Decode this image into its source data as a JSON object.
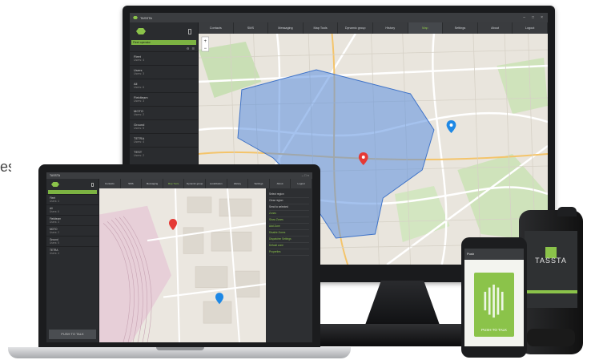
{
  "edge_text": "es",
  "monitor": {
    "app_name": "TASSTA",
    "window_buttons": [
      "–",
      "□",
      "×"
    ],
    "user_label": "Fleet operator",
    "tabs": [
      {
        "label": "Contacts",
        "active": false
      },
      {
        "label": "SMS",
        "active": false
      },
      {
        "label": "Messaging",
        "active": false
      },
      {
        "label": "Map Tools",
        "active": false
      },
      {
        "label": "Dynamic group",
        "active": false
      },
      {
        "label": "History",
        "active": false
      },
      {
        "label": "Map",
        "active": true
      },
      {
        "label": "Settings",
        "active": false
      },
      {
        "label": "About",
        "active": false
      },
      {
        "label": "Logout",
        "active": false
      }
    ],
    "groups": [
      {
        "name": "Fleet",
        "sub": "Users: 4"
      },
      {
        "name": "Users",
        "sub": "Users: 3"
      },
      {
        "name": "All",
        "sub": "Users: 6"
      },
      {
        "name": "Fieldteam",
        "sub": "Users: 3"
      },
      {
        "name": "MOTO",
        "sub": "Users: 2"
      },
      {
        "name": "Ground",
        "sub": "Users: 5"
      },
      {
        "name": "TETRA",
        "sub": "Users: 4"
      },
      {
        "name": "TEST",
        "sub": "Users: 2"
      }
    ]
  },
  "laptop": {
    "app_name": "TASSTA",
    "tabs": [
      {
        "label": "Contacts",
        "active": false
      },
      {
        "label": "SMS",
        "active": false
      },
      {
        "label": "Messaging",
        "active": false
      },
      {
        "label": "Map Tools",
        "active": true
      },
      {
        "label": "Dynamic group",
        "active": false
      },
      {
        "label": "Localization",
        "active": false
      },
      {
        "label": "History",
        "active": false
      },
      {
        "label": "Settings",
        "active": false
      },
      {
        "label": "About",
        "active": false
      },
      {
        "label": "Logout",
        "active": false
      }
    ],
    "groups": [
      {
        "name": "Fleet",
        "sub": "Users: 4"
      },
      {
        "name": "All",
        "sub": "Users: 6"
      },
      {
        "name": "Fieldteam",
        "sub": "Users: 3"
      },
      {
        "name": "MOTO",
        "sub": "Users: 2"
      },
      {
        "name": "Ground",
        "sub": "Users: 5"
      },
      {
        "name": "TETRA",
        "sub": "Users: 4"
      }
    ],
    "ptt_label": "PUSH TO TALK",
    "panel_items": [
      {
        "label": "Select region",
        "green": false
      },
      {
        "label": "Clear region",
        "green": false
      },
      {
        "label": "Send to selected",
        "green": false
      },
      {
        "label": "Zones",
        "green": true
      },
      {
        "label": "Show Zones",
        "green": true
      },
      {
        "label": "Add Zone",
        "green": true
      },
      {
        "label": "Disable Zones",
        "green": true
      },
      {
        "label": "Dispatcher Settings",
        "green": true
      },
      {
        "label": "Default zone",
        "green": true
      },
      {
        "label": "Properties",
        "green": true
      }
    ]
  },
  "phone": {
    "topbar": "Push",
    "ptt_label": "PUSH TO TALK"
  },
  "rugged": {
    "brand": "TASSTA"
  },
  "colors": {
    "accent": "#8bc34a",
    "zone": "#5b8fe0",
    "marker_red": "#e53935",
    "marker_blue": "#1e88e5"
  }
}
